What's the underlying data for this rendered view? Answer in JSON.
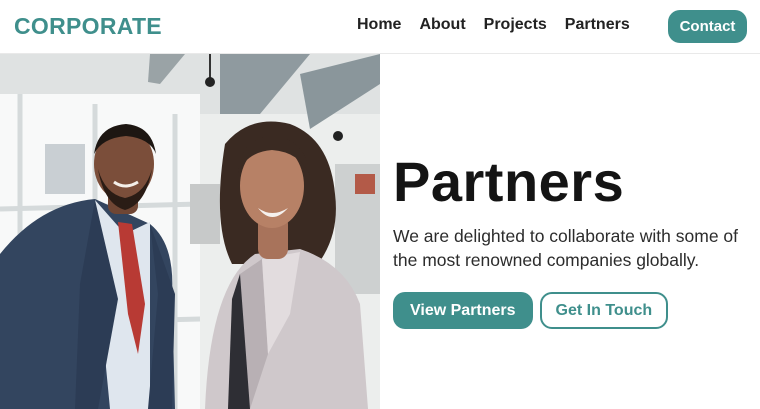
{
  "brand": {
    "name": "CORPORATE"
  },
  "nav": {
    "links": [
      "Home",
      "About",
      "Projects",
      "Partners"
    ],
    "cta_label": "Contact"
  },
  "hero": {
    "title": "Partners",
    "description": "We are delighted to collaborate with some of the most renowned companies globally.",
    "primary_button": "View Partners",
    "secondary_button": "Get In Touch",
    "image_subject": "Two smiling business professionals in an office"
  },
  "colors": {
    "accent": "#3f8f8c",
    "text_dark": "#141414",
    "background": "#ffffff"
  }
}
